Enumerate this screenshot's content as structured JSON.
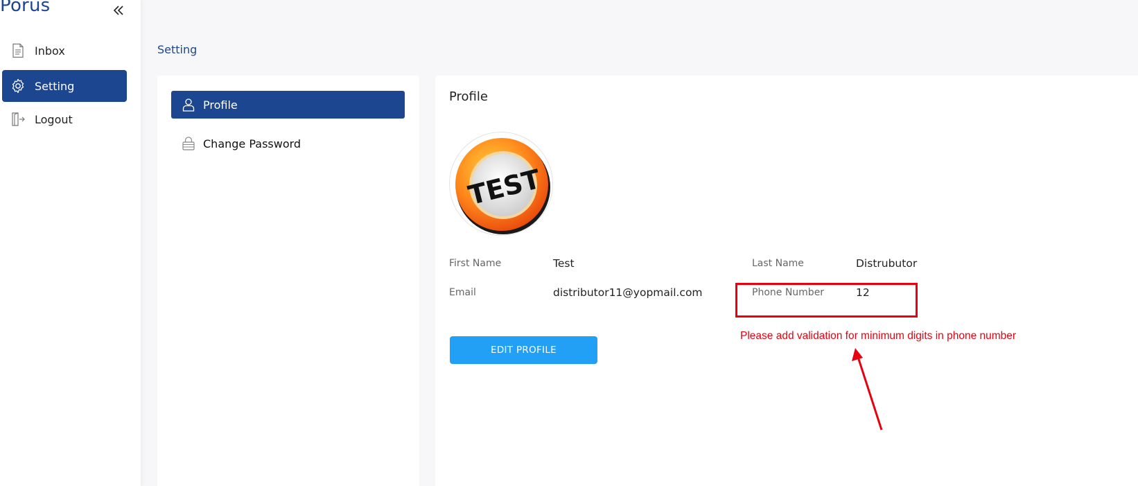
{
  "app": {
    "brand": "Porus",
    "collapse_icon": "double-chevron-left-icon"
  },
  "sidebar": {
    "items": [
      {
        "label": "Inbox",
        "icon": "document-icon",
        "active": false
      },
      {
        "label": "Setting",
        "icon": "gear-icon",
        "active": true
      },
      {
        "label": "Logout",
        "icon": "logout-icon",
        "active": false
      }
    ]
  },
  "page": {
    "title": "Setting"
  },
  "settings_menu": {
    "items": [
      {
        "label": "Profile",
        "icon": "user-icon",
        "active": true
      },
      {
        "label": "Change Password",
        "icon": "lock-icon",
        "active": false
      }
    ]
  },
  "profile": {
    "title": "Profile",
    "avatar_text": "TEST",
    "fields": {
      "first_name_label": "First Name",
      "first_name_value": "Test",
      "last_name_label": "Last Name",
      "last_name_value": "Distrubutor",
      "email_label": "Email",
      "email_value": "distributor11@yopmail.com",
      "phone_label": "Phone Number",
      "phone_value": "12"
    },
    "edit_button": "EDIT PROFILE"
  },
  "annotation": {
    "text": "Please add validation for minimum digits in phone number",
    "color": "#e8000f"
  },
  "colors": {
    "brand": "#1d4690",
    "accent_button": "#22a0f5",
    "background": "#f7f7fa"
  }
}
